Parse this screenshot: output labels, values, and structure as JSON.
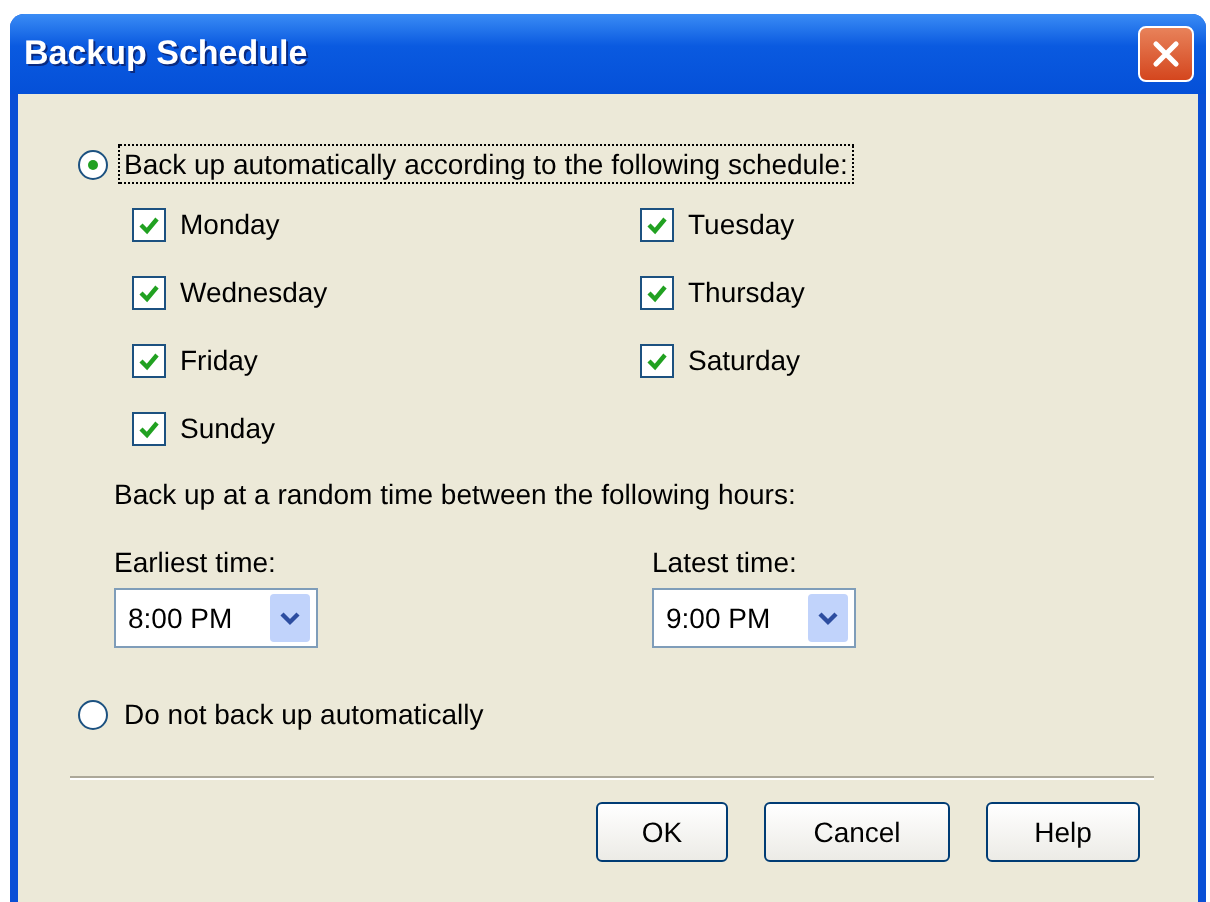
{
  "window": {
    "title": "Backup Schedule"
  },
  "options": [
    {
      "label": "Back up automatically according to the following schedule:",
      "selected": true,
      "focused": true
    },
    {
      "label": "Do not back up automatically",
      "selected": false,
      "focused": false
    }
  ],
  "days": [
    {
      "label": "Monday",
      "checked": true
    },
    {
      "label": "Tuesday",
      "checked": true
    },
    {
      "label": "Wednesday",
      "checked": true
    },
    {
      "label": "Thursday",
      "checked": true
    },
    {
      "label": "Friday",
      "checked": true
    },
    {
      "label": "Saturday",
      "checked": true
    },
    {
      "label": "Sunday",
      "checked": true
    }
  ],
  "hours_label": "Back up at a random time between the following hours:",
  "times": [
    {
      "label": "Earliest time:",
      "value": "8:00 PM"
    },
    {
      "label": "Latest time:",
      "value": "9:00 PM"
    }
  ],
  "buttons": [
    "OK",
    "Cancel",
    "Help"
  ]
}
